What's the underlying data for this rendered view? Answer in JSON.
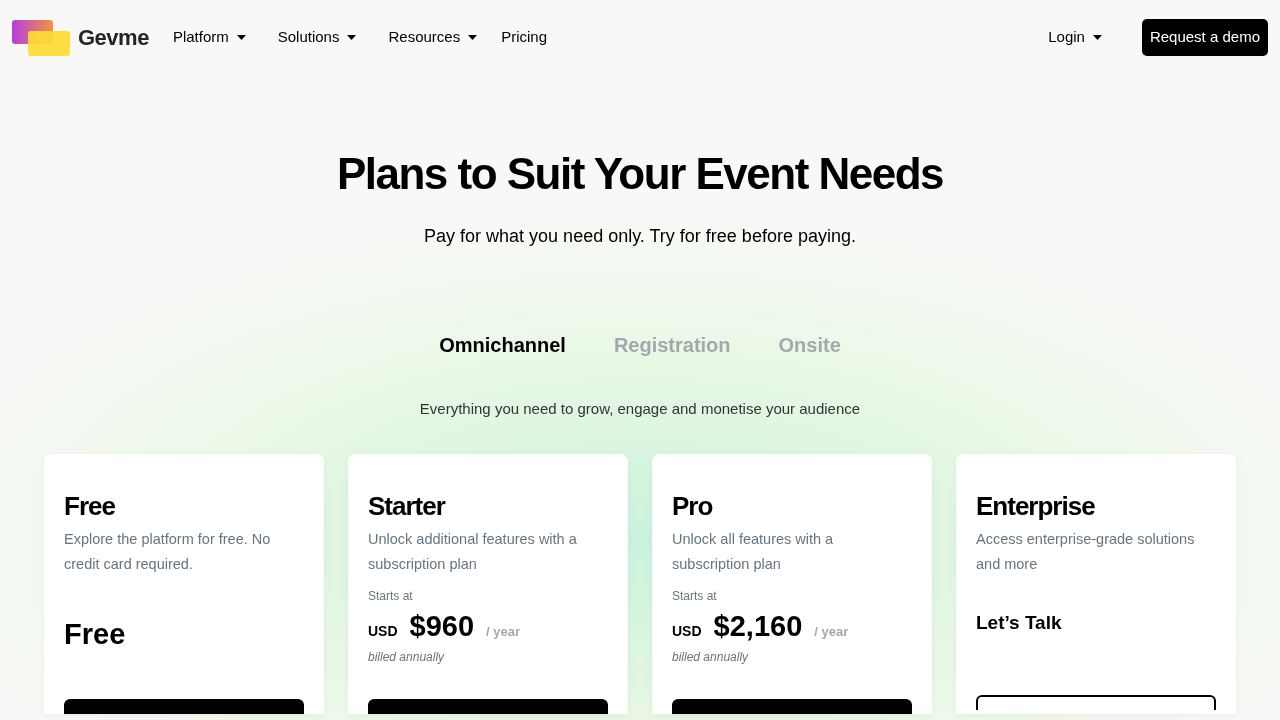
{
  "navbar": {
    "brand": "Gevme",
    "menu": [
      {
        "label": "Platform",
        "dropdown": true
      },
      {
        "label": "Solutions",
        "dropdown": true
      },
      {
        "label": "Resources",
        "dropdown": true
      },
      {
        "label": "Pricing",
        "dropdown": false
      }
    ],
    "login": {
      "label": "Login",
      "dropdown": true
    },
    "cta": "Request a demo"
  },
  "hero": {
    "title": "Plans to Suit Your Event Needs",
    "subtitle": "Pay for what you need only. Try for free before paying."
  },
  "tabs": [
    {
      "label": "Omnichannel",
      "selected": true
    },
    {
      "label": "Registration",
      "selected": false
    },
    {
      "label": "Onsite",
      "selected": false
    }
  ],
  "tab_description": "Everything you need to grow, engage and monetise your audience",
  "plans": [
    {
      "name": "Free",
      "description": "Explore the platform for free. No credit card required.",
      "kind": "plain",
      "price": "Free",
      "button": {
        "kind": "filled"
      }
    },
    {
      "name": "Starter",
      "description": "Unlock additional features with a subscription plan",
      "kind": "priced",
      "starts_at": "Starts at",
      "currency": "USD",
      "price": "$960",
      "period": "/ year",
      "billing": "billed annually",
      "button": {
        "kind": "filled"
      }
    },
    {
      "name": "Pro",
      "description": "Unlock all features with a subscription plan",
      "kind": "priced",
      "starts_at": "Starts at",
      "currency": "USD",
      "price": "$2,160",
      "period": "/ year",
      "billing": "billed annually",
      "button": {
        "kind": "filled"
      }
    },
    {
      "name": "Enterprise",
      "description": "Access enterprise-grade solutions and more",
      "kind": "contact",
      "price": "Let’s Talk",
      "button": {
        "kind": "outline"
      }
    }
  ]
}
